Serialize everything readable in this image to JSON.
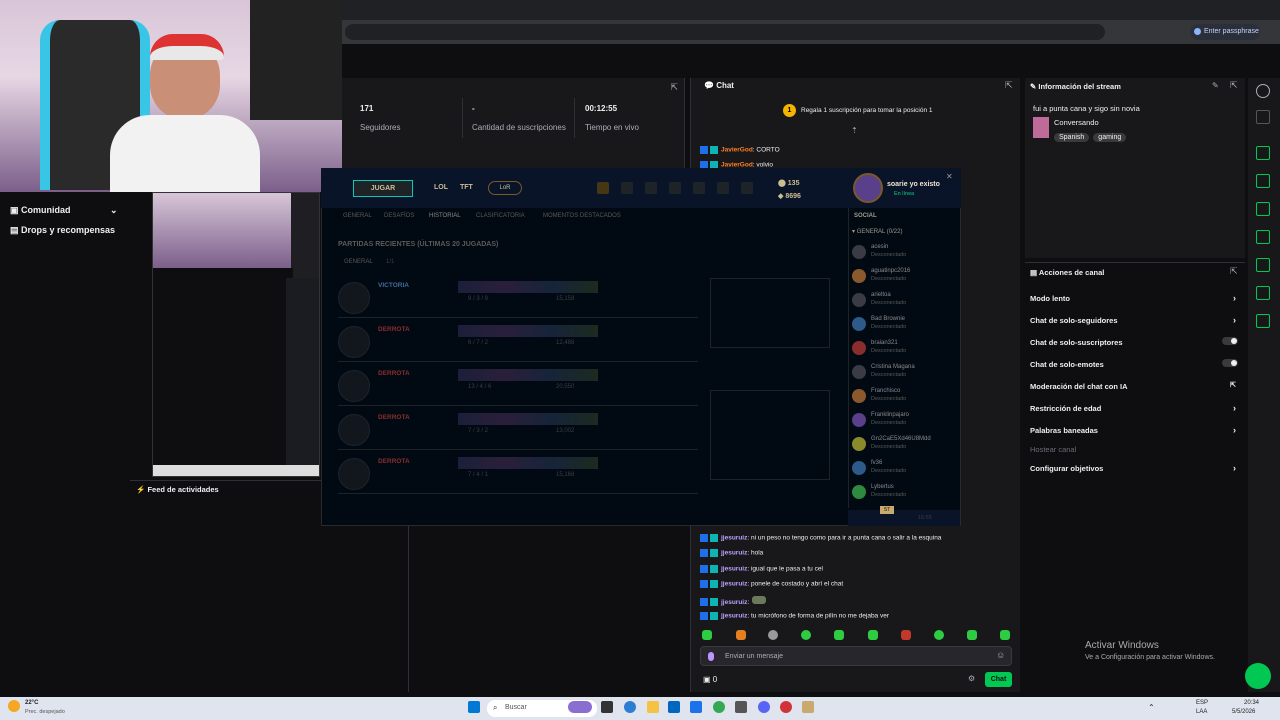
{
  "browser": {
    "passphrase_label": "Enter passphrase"
  },
  "stats": [
    {
      "value": "171",
      "label": "Seguidores"
    },
    {
      "value": "-",
      "label": "Cantidad de suscripciones"
    },
    {
      "value": "00:12:55",
      "label": "Tiempo en vivo"
    }
  ],
  "sidebar": {
    "community": "Comunidad",
    "drops": "Drops y recompensas"
  },
  "activity": {
    "title": "Feed de actividades"
  },
  "chat": {
    "title": "Chat",
    "gift_banner": "Regala 1 suscripción para tomar la posición 1",
    "gift_rank": "1",
    "top_lines": [
      {
        "user": "JavierGod",
        "msg": ": CORTO"
      },
      {
        "user": "JavierGod",
        "msg": ": volvio"
      }
    ],
    "lines": [
      {
        "user": "jjesuruiz",
        "msg": ": ni un peso no tengo como para ir a punta cana o salir a la esquina"
      },
      {
        "user": "jjesuruiz",
        "msg": ": hola"
      },
      {
        "user": "jjesuruiz",
        "msg": ": igual que le pasa a tu cel"
      },
      {
        "user": "jjesuruiz",
        "msg": ": ponele de costado y abrí el chat"
      },
      {
        "user": "jjesuruiz",
        "msg": ":"
      },
      {
        "user": "jjesuruiz",
        "msg": ": tu micrófono de forma de pilín no me dejaba ver"
      }
    ],
    "input_placeholder": "Enviar un mensaje",
    "points": "0",
    "send_label": "Chat"
  },
  "stream_info": {
    "title": "Información del stream",
    "stream_title": "fui a punta cana y sigo sin novia",
    "category": "Conversando",
    "tags": [
      "Spanish",
      "gaming"
    ]
  },
  "mod_actions": {
    "title": "Acciones de canal",
    "items": [
      {
        "label": "Modo lento",
        "control": "arrow"
      },
      {
        "label": "Chat de solo-seguidores",
        "control": "arrow"
      },
      {
        "label": "Chat de solo-suscriptores",
        "control": "toggle"
      },
      {
        "label": "Chat de solo-emotes",
        "control": "toggle"
      },
      {
        "label": "Moderación del chat con IA",
        "control": "link"
      },
      {
        "label": "Restricción de edad",
        "control": "arrow"
      },
      {
        "label": "Palabras baneadas",
        "control": "arrow"
      },
      {
        "label": "Hostear canal",
        "control": "none"
      },
      {
        "label": "Configurar objetivos",
        "control": "arrow"
      }
    ]
  },
  "windows_notice": {
    "title": "Activar Windows",
    "subtitle": "Ve a Configuración para activar Windows."
  },
  "lol": {
    "play": "JUGAR",
    "nav": [
      "LOL",
      "TFT"
    ],
    "lor": "LoR",
    "subnav": [
      "GENERAL",
      "DESAFÍOS",
      "HISTORIAL",
      "CLASIFICATORIA",
      "MOMENTOS DESTACADOS"
    ],
    "history_title": "PARTIDAS RECIENTES (ÚLTIMAS 20 JUGADAS)",
    "filter": [
      "GENERAL",
      "1/1"
    ],
    "rp": "135",
    "be": "8696",
    "player_name": "soarie yo existo",
    "player_status": "En línea",
    "social_label": "SOCIAL",
    "group_label": "GENERAL (0/22)",
    "matches": [
      {
        "result": "VICTORIA",
        "kda": "9 / 3 / 9",
        "gold": "15,158",
        "color": "#3e6e9a"
      },
      {
        "result": "DERROTA",
        "kda": "6 / 7 / 2",
        "gold": "12,488",
        "color": "#8a2d2d"
      },
      {
        "result": "DERROTA",
        "kda": "13 / 4 / 6",
        "gold": "20,550",
        "color": "#8a2d2d"
      },
      {
        "result": "DERROTA",
        "kda": "7 / 3 / 2",
        "gold": "13,002",
        "color": "#8a2d2d"
      },
      {
        "result": "DERROTA",
        "kda": "7 / 4 / 1",
        "gold": "15,168",
        "color": "#8a2d2d"
      }
    ],
    "friends": [
      {
        "name": "acesin",
        "status": "Desconectado"
      },
      {
        "name": "aguatinpc2016",
        "status": "Desconectado"
      },
      {
        "name": "arieltoa",
        "status": "Desconectado"
      },
      {
        "name": "Bad Brownie",
        "status": "Desconectado"
      },
      {
        "name": "braian321",
        "status": "Desconectado"
      },
      {
        "name": "Cristina Magana",
        "status": "Desconectado"
      },
      {
        "name": "Franchisco",
        "status": "Desconectado"
      },
      {
        "name": "Franklinpajaro",
        "status": "Desconectado"
      },
      {
        "name": "Gn2CaE5Xd46U8Mdd",
        "status": "Desconectado"
      },
      {
        "name": "fv36",
        "status": "Desconectado"
      },
      {
        "name": "Lybertus",
        "status": "Desconectado"
      }
    ],
    "badge_count": "57",
    "time_hint": "16:55"
  },
  "taskbar": {
    "weather_temp": "22°C",
    "weather_desc": "Prec. despejado",
    "search": "Buscar",
    "lang": "ESP",
    "lang2": "LAA",
    "time": "20:34",
    "date": "5/5/2026"
  }
}
